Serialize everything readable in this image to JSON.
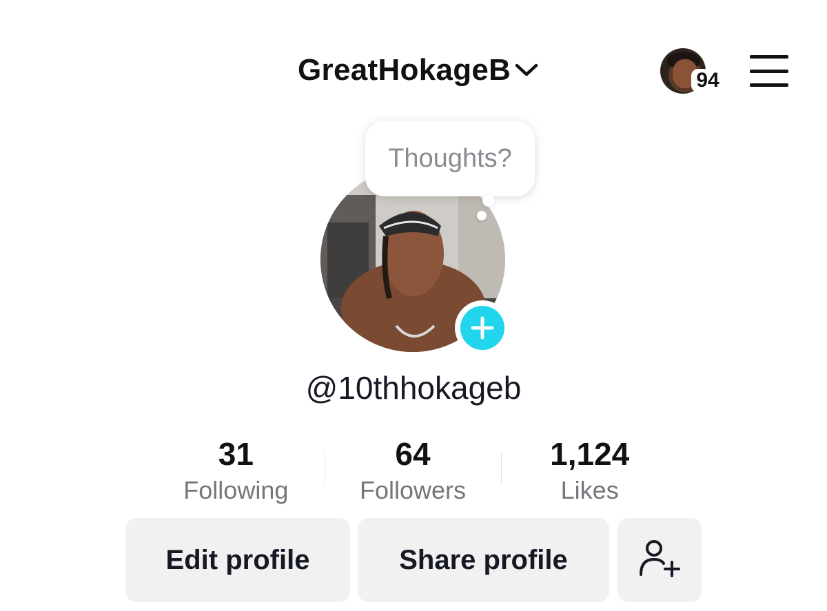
{
  "header": {
    "account_name": "GreatHokageB",
    "switcher_icon": "chevron-down-icon",
    "notification_count": "94",
    "menu_icon": "hamburger-menu-icon"
  },
  "profile": {
    "note_text": "Thoughts?",
    "handle": "@10thhokageb",
    "add_photo_icon": "plus-icon"
  },
  "stats": [
    {
      "value": "31",
      "label": "Following"
    },
    {
      "value": "64",
      "label": "Followers"
    },
    {
      "value": "1,124",
      "label": "Likes"
    }
  ],
  "actions": {
    "edit_label": "Edit profile",
    "share_label": "Share profile",
    "add_friend_icon": "add-user-icon"
  },
  "colors": {
    "accent_cyan": "#20d5ec",
    "button_bg": "#f1f1f2",
    "secondary_text": "#75767b"
  }
}
